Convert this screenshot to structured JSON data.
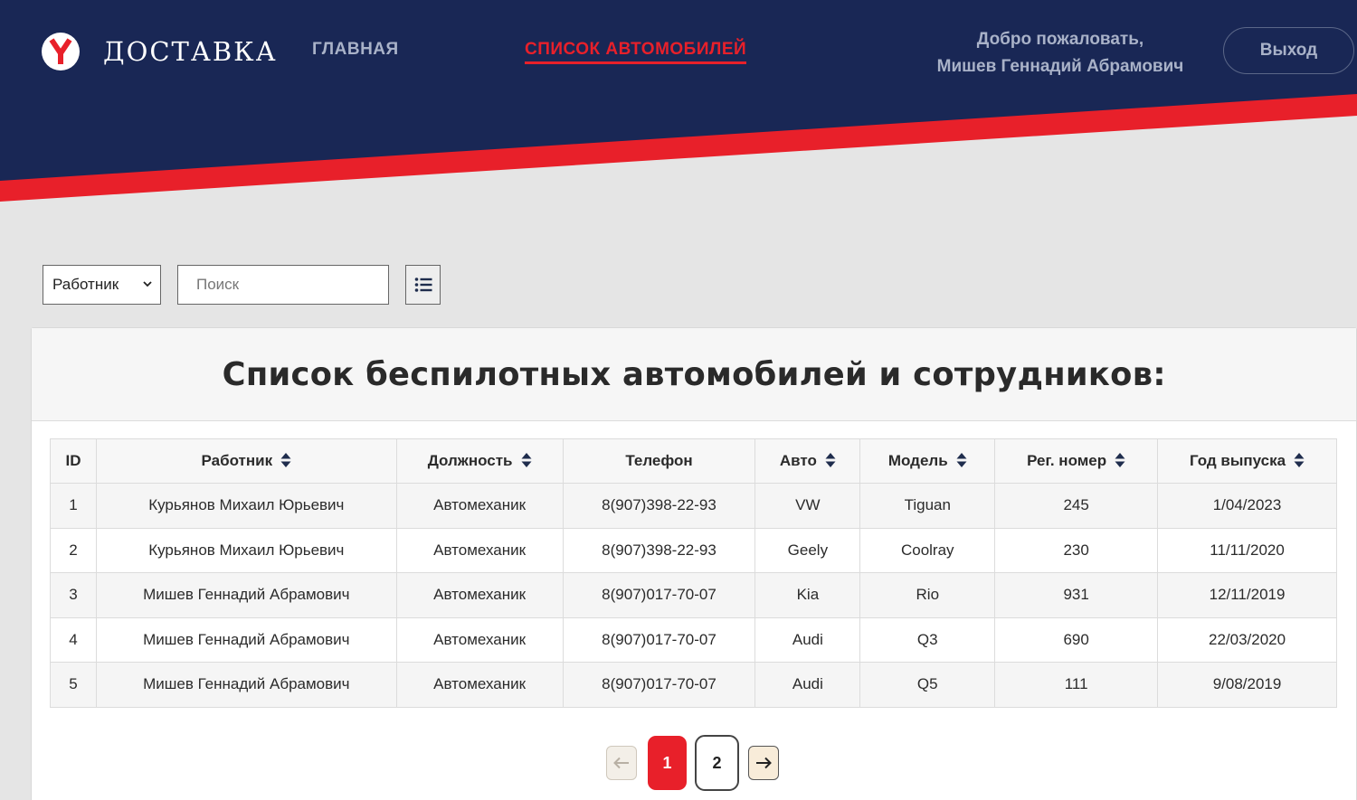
{
  "colors": {
    "navy": "#192755",
    "red": "#e8202a",
    "bg": "#e5e5e5",
    "nav_text": "#a9b2c8"
  },
  "header": {
    "logo_icon": "yandex-y-logo",
    "logo_text": "ДОСТАВКА",
    "nav": {
      "home": "ГЛАВНАЯ",
      "cars": "СПИСОК АВТОМОБИЛЕЙ"
    },
    "welcome_line1": "Добро пожаловать,",
    "welcome_line2": "Мишев Геннадий Абрамович",
    "logout": "Выход"
  },
  "filters": {
    "select_value": "Работник",
    "search_placeholder": "Поиск",
    "list_icon": "list-icon"
  },
  "card": {
    "title": "Список беспилотных автомобилей и сотрудников:"
  },
  "table": {
    "headers": [
      "ID",
      "Работник",
      "Должность",
      "Телефон",
      "Авто",
      "Модель",
      "Рег. номер",
      "Год выпуска"
    ],
    "rows": [
      [
        "1",
        "Курьянов Михаил Юрьевич",
        "Автомеханик",
        "8(907)398-22-93",
        "VW",
        "Tiguan",
        "245",
        "1/04/2023"
      ],
      [
        "2",
        "Курьянов Михаил Юрьевич",
        "Автомеханик",
        "8(907)398-22-93",
        "Geely",
        "Coolray",
        "230",
        "11/11/2020"
      ],
      [
        "3",
        "Мишев Геннадий Абрамович",
        "Автомеханик",
        "8(907)017-70-07",
        "Kia",
        "Rio",
        "931",
        "12/11/2019"
      ],
      [
        "4",
        "Мишев Геннадий Абрамович",
        "Автомеханик",
        "8(907)017-70-07",
        "Audi",
        "Q3",
        "690",
        "22/03/2020"
      ],
      [
        "5",
        "Мишев Геннадий Абрамович",
        "Автомеханик",
        "8(907)017-70-07",
        "Audi",
        "Q5",
        "111",
        "9/08/2019"
      ]
    ]
  },
  "pagination": {
    "pages": [
      "1",
      "2"
    ],
    "current": "1"
  }
}
